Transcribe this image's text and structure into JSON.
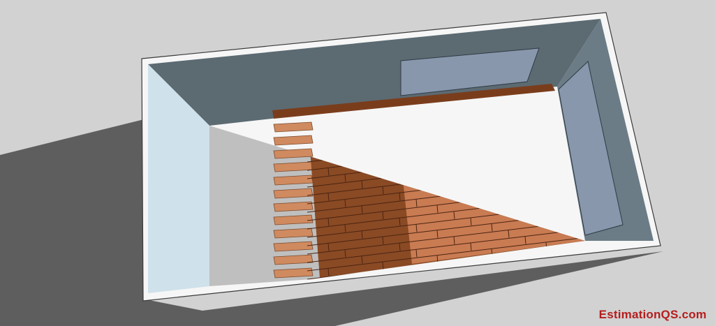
{
  "watermark": {
    "text": "EstimationQS.com",
    "color": "#b41e1e"
  },
  "scene": {
    "subject": "isometric room floor with partially laid wooden flooring",
    "colors": {
      "background": "#d2d2d2",
      "shadow": "#5e5e5e",
      "wall_top": "#f6f6f6",
      "back_wall": "#5c6a72",
      "left_wall": "#cfe1ea",
      "right_wall": "#6b7c86",
      "window": "#8897ac",
      "concrete": "#bfbfbf",
      "battens": "#d08a5f",
      "flooring_shaded": "#8a4a24",
      "flooring_lit": "#c97b52",
      "board_seam": "#4a2412"
    },
    "icons": [
      "window-icon",
      "door-icon"
    ]
  }
}
